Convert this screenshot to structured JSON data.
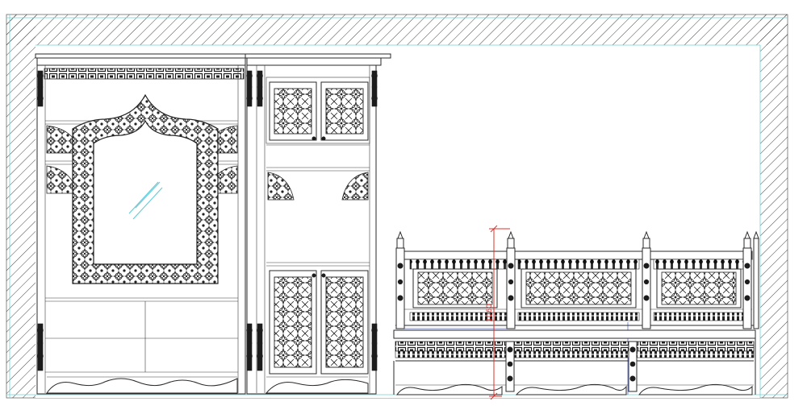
{
  "drawing": {
    "dimension_label": "1060",
    "colors": {
      "lines": "#2a2a2a",
      "hatch": "#333333",
      "guide": "#6fd3d3",
      "dimension": "#e0302a",
      "glass": "#5cc8d6",
      "background": "#ffffff"
    }
  }
}
